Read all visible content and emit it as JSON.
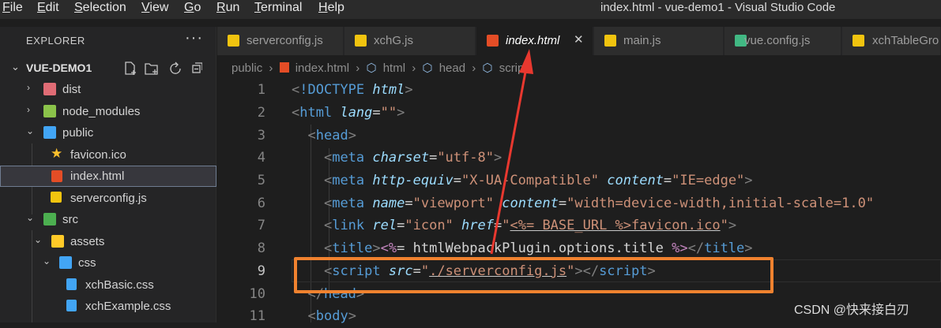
{
  "menu": {
    "items": [
      "File",
      "Edit",
      "Selection",
      "View",
      "Go",
      "Run",
      "Terminal",
      "Help"
    ],
    "mnemonics": [
      "F",
      "E",
      "S",
      "V",
      "G",
      "R",
      "T",
      "H"
    ]
  },
  "window": {
    "title": "index.html - vue-demo1 - Visual Studio Code"
  },
  "explorer": {
    "header": "EXPLORER",
    "more": "···",
    "project": "VUE-DEMO1",
    "project_chevron": "⌄",
    "action_icons": [
      "new-file-icon",
      "new-folder-icon",
      "refresh-icon",
      "collapse-all-icon"
    ],
    "tree": [
      {
        "label": "dist",
        "chevron": "›",
        "icon": "folder-dist-icon",
        "color": "#e06c75"
      },
      {
        "label": "node_modules",
        "chevron": "›",
        "icon": "folder-node-icon",
        "color": "#8bc34a"
      },
      {
        "label": "public",
        "chevron": "⌄",
        "icon": "folder-public-icon",
        "color": "#42a5f5"
      },
      {
        "label": "favicon.ico",
        "chevron": "",
        "icon": "star-icon",
        "color": "#fbc02d"
      },
      {
        "label": "index.html",
        "chevron": "",
        "icon": "html5-icon",
        "color": "#e44d26"
      },
      {
        "label": "serverconfig.js",
        "chevron": "",
        "icon": "js-icon",
        "color": "#f1c40f"
      },
      {
        "label": "src",
        "chevron": "⌄",
        "icon": "folder-src-icon",
        "color": "#4caf50"
      },
      {
        "label": "assets",
        "chevron": "⌄",
        "icon": "folder-assets-icon",
        "color": "#ffca28"
      },
      {
        "label": "css",
        "chevron": "⌄",
        "icon": "folder-css-icon",
        "color": "#42a5f5"
      },
      {
        "label": "xchBasic.css",
        "chevron": "",
        "icon": "css-icon",
        "color": "#42a5f5"
      },
      {
        "label": "xchExample.css",
        "chevron": "",
        "icon": "css-icon",
        "color": "#42a5f5"
      }
    ]
  },
  "tabs": [
    {
      "label": "serverconfig.js",
      "icon": "js-icon",
      "color": "#f1c40f"
    },
    {
      "label": "xchG.js",
      "icon": "js-icon",
      "color": "#f1c40f"
    },
    {
      "label": "index.html",
      "icon": "html5-icon",
      "color": "#e44d26",
      "active": true,
      "close": "✕"
    },
    {
      "label": "main.js",
      "icon": "js-icon",
      "color": "#f1c40f"
    },
    {
      "label": "vue.config.js",
      "icon": "vue-config-icon",
      "color": "#41b883"
    },
    {
      "label": "xchTableGro",
      "icon": "js-icon",
      "color": "#f1c40f"
    }
  ],
  "breadcrumb": [
    "public",
    "›",
    "index.html",
    "›",
    "html",
    "›",
    "head",
    "›",
    "script"
  ],
  "editor": {
    "line_numbers": [
      "1",
      "2",
      "3",
      "4",
      "5",
      "6",
      "7",
      "8",
      "9",
      "10",
      "11"
    ],
    "current_line": "9"
  },
  "watermark": "CSDN @快来接白刃"
}
